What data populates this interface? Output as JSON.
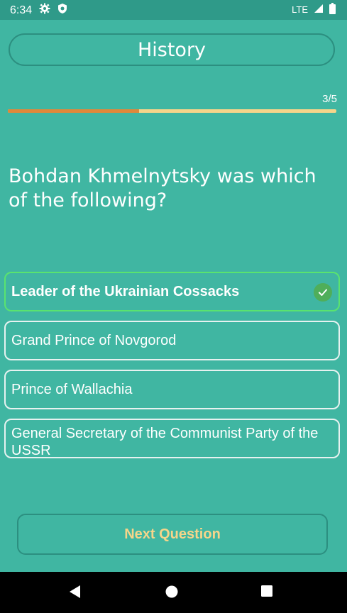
{
  "status_bar": {
    "time": "6:34",
    "network": "LTE",
    "icons": [
      "gear-icon",
      "shield-icon",
      "signal-icon",
      "battery-icon"
    ]
  },
  "header": {
    "title": "History"
  },
  "progress": {
    "text": "3/5",
    "current": 3,
    "total": 5,
    "fraction": 0.4
  },
  "question": {
    "text": "Bohdan Khmelnytsky was which of the following?"
  },
  "answers": [
    {
      "label": "Leader of the Ukrainian Cossacks",
      "state": "correct"
    },
    {
      "label": "Grand Prince of Novgorod",
      "state": "default"
    },
    {
      "label": "Prince of Wallachia",
      "state": "default"
    },
    {
      "label": "General Secretary of the Communist Party of the USSR",
      "state": "default"
    }
  ],
  "next_button": {
    "label": "Next Question"
  },
  "nav": {
    "icons": [
      "back-icon",
      "home-icon",
      "recents-icon"
    ]
  },
  "colors": {
    "background": "#40b6a2",
    "status_bar": "#2f9a89",
    "progress_fill": "#e0883a",
    "progress_track": "#f6d58a",
    "correct_border": "#5ae36f",
    "check_badge": "#4fae5a",
    "next_label": "#f6d58a"
  }
}
